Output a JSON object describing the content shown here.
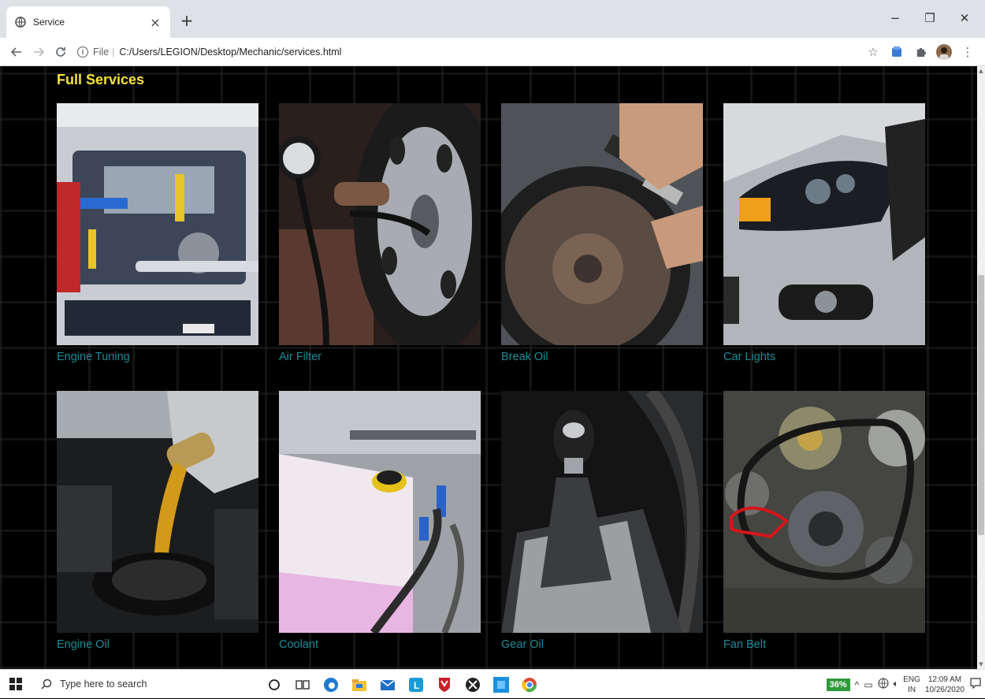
{
  "browser": {
    "tab_title": "Service",
    "tab_close": "×",
    "new_tab": "+",
    "scheme": "File",
    "separator": "|",
    "url": "C:/Users/LEGION/Desktop/Mechanic/services.html",
    "window_controls": {
      "minimize": "−",
      "maximize": "❐",
      "close": "✕"
    }
  },
  "page": {
    "section_title": "Full Services",
    "services": [
      {
        "label": "Engine Tuning",
        "image": "engine-bay"
      },
      {
        "label": "Air Filter",
        "image": "tire-gauge"
      },
      {
        "label": "Break Oil",
        "image": "brake-disc"
      },
      {
        "label": "Car Lights",
        "image": "headlight"
      },
      {
        "label": "Engine Oil",
        "image": "oil-pour"
      },
      {
        "label": "Coolant",
        "image": "coolant-tank"
      },
      {
        "label": "Gear Oil",
        "image": "gear-shifter"
      },
      {
        "label": "Fan Belt",
        "image": "fan-belt"
      }
    ]
  },
  "taskbar": {
    "search_placeholder": "Type here to search",
    "battery": "36%",
    "lang_top": "ENG",
    "lang_bottom": "IN",
    "time": "12:09 AM",
    "date": "10/26/2020"
  },
  "colors": {
    "title": "#f5e23b",
    "label": "#1e8c9a",
    "page_bg": "#000000"
  }
}
